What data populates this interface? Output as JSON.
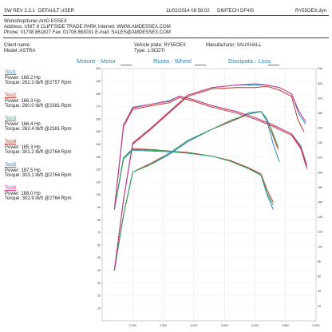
{
  "header": {
    "software": "SW REV 2.3.1",
    "user": "DEFAULT USER",
    "datetime": "11/02/2014 08:59:02",
    "dyno_model": "DIMTECH DF4IS",
    "file": "RY55OEX.dyn",
    "workshop_name": "Workshop/tuner:AmD ESSEX",
    "address": "Address: UNIT 6 CLIFFSIDE TRADE PARK Internet: WWW.AMDESSEX.COM",
    "phone": "Phone: 01708 861827 Fax: 01708 863031 E-mail: SALES@AMDESSEX.COM"
  },
  "vehicle": {
    "client_name_label": "Client name:",
    "model": "Model: ASTRA",
    "plate": "Vehicle plate: RY55OEX",
    "type": "Type: 1.9CDTI",
    "manufacturer": "Manufacturer: VAUXHALL"
  },
  "legend": [
    "Motore - Motor",
    "Ruota - Wheel",
    "Dissipata - Loss"
  ],
  "tests": [
    {
      "name": "Test1",
      "color": "#2e86c1",
      "power": "Power: 166.2 Hp",
      "torque": "Torque: 262.3 lb/ft @2757 Rpm"
    },
    {
      "name": "Test2",
      "color": "#c0392b",
      "power": "Power: 166.3 Hp",
      "torque": "Torque: 260.0 lb/ft @2381 Rpm"
    },
    {
      "name": "Test3",
      "color": "#27ae60",
      "power": "Power: 166.4 Hp",
      "torque": "Torque: 262.4 lb/ft @2381 Rpm"
    },
    {
      "name": "Test4",
      "color": "#c0392b",
      "power": "Power: 185.3 Hp",
      "torque": "Torque: 301.2 lb/ft @2764 Rpm"
    },
    {
      "name": "Test5",
      "color": "#2e86c1",
      "power": "Power: 187.5 Hp",
      "torque": "Torque: 303.1 lb/ft @2764 Rpm"
    },
    {
      "name": "Test6",
      "color": "#d63384",
      "power": "Power: 188.0 Hp",
      "torque": "Torque: 302.9 lb/ft @2764 Rpm"
    }
  ],
  "chart_data": {
    "type": "line",
    "xlim": [
      1500,
      5000
    ],
    "x_ticks": [
      2000,
      2500,
      3000,
      3500,
      4000,
      4500,
      5000
    ],
    "power_ylim": [
      0,
      200
    ],
    "power_ticks": [
      10,
      20,
      30,
      40,
      50,
      60,
      70,
      80,
      90,
      100,
      110,
      120,
      130,
      140,
      150,
      160,
      170,
      180,
      190,
      200
    ],
    "torque_ylim": [
      0,
      340
    ],
    "torque_ticks": [
      20,
      40,
      60,
      80,
      100,
      120,
      140,
      160,
      180,
      200,
      220,
      240,
      260,
      280,
      300,
      320,
      340
    ],
    "series": [
      {
        "color": "#2e86c1",
        "kind": "power",
        "x": [
          1700,
          1850,
          2000,
          2300,
          2600,
          2900,
          3300,
          3600,
          3900,
          4100,
          4200,
          4300,
          4400
        ],
        "y": [
          40,
          84,
          118,
          124,
          132,
          142,
          152,
          158,
          165,
          166,
          158,
          140,
          126
        ]
      },
      {
        "color": "#c0392b",
        "kind": "power",
        "x": [
          1700,
          1850,
          2000,
          2300,
          2600,
          2900,
          3300,
          3600,
          3900,
          4100,
          4200,
          4300,
          4380
        ],
        "y": [
          40,
          84,
          118,
          125,
          133,
          143,
          152,
          158,
          164,
          166,
          160,
          146,
          136
        ]
      },
      {
        "color": "#27ae60",
        "kind": "power",
        "x": [
          1700,
          1850,
          2000,
          2300,
          2600,
          2900,
          3300,
          3600,
          3900,
          4100,
          4200,
          4300,
          4380
        ],
        "y": [
          40,
          84,
          118,
          124,
          133,
          143,
          152,
          159,
          164,
          166,
          160,
          148,
          138
        ]
      },
      {
        "color": "#c0392b",
        "kind": "power",
        "x": [
          1700,
          1850,
          2000,
          2300,
          2600,
          2900,
          3300,
          3700,
          4000,
          4200,
          4400,
          4600,
          4700,
          4800
        ],
        "y": [
          40,
          96,
          140,
          152,
          165,
          178,
          184,
          185,
          185,
          186,
          183,
          178,
          160,
          150
        ]
      },
      {
        "color": "#2e86c1",
        "kind": "power",
        "x": [
          1700,
          1850,
          2000,
          2300,
          2600,
          2900,
          3300,
          3700,
          4000,
          4200,
          4400,
          4600,
          4720,
          4830
        ],
        "y": [
          40,
          96,
          141,
          153,
          166,
          179,
          185,
          187,
          187,
          187,
          185,
          180,
          164,
          156
        ]
      },
      {
        "color": "#d63384",
        "kind": "power",
        "x": [
          1700,
          1850,
          2000,
          2300,
          2600,
          2900,
          3300,
          3700,
          4000,
          4200,
          4400,
          4600,
          4720,
          4830
        ],
        "y": [
          40,
          96,
          141,
          153,
          166,
          179,
          185,
          187,
          188,
          187,
          185,
          180,
          166,
          158
        ]
      },
      {
        "color": "#2e86c1",
        "kind": "torque",
        "x": [
          1700,
          1850,
          2000,
          2300,
          2600,
          2900,
          3300,
          3600,
          3900,
          4100,
          4200,
          4300
        ],
        "y": [
          150,
          218,
          230,
          229,
          228,
          226,
          222,
          216,
          206,
          196,
          170,
          150
        ]
      },
      {
        "color": "#c0392b",
        "kind": "torque",
        "x": [
          1700,
          1850,
          2000,
          2300,
          2600,
          2900,
          3300,
          3600,
          3900,
          4100,
          4200,
          4300
        ],
        "y": [
          150,
          220,
          232,
          231,
          229,
          227,
          222,
          216,
          206,
          198,
          176,
          160
        ]
      },
      {
        "color": "#27ae60",
        "kind": "torque",
        "x": [
          1700,
          1850,
          2000,
          2300,
          2600,
          2900,
          3300,
          3600,
          3900,
          4100,
          4200,
          4300
        ],
        "y": [
          150,
          220,
          231,
          230,
          229,
          226,
          222,
          215,
          205,
          196,
          172,
          156
        ]
      },
      {
        "color": "#c0392b",
        "kind": "torque",
        "x": [
          1700,
          1850,
          2000,
          2300,
          2600,
          2764,
          3000,
          3300,
          3700,
          4000,
          4300,
          4600,
          4750,
          4850
        ],
        "y": [
          150,
          262,
          285,
          290,
          294,
          301,
          296,
          288,
          280,
          272,
          262,
          250,
          232,
          205
        ]
      },
      {
        "color": "#2e86c1",
        "kind": "torque",
        "x": [
          1700,
          1850,
          2000,
          2300,
          2600,
          2764,
          3000,
          3300,
          3700,
          4000,
          4300,
          4600,
          4750,
          4850
        ],
        "y": [
          150,
          264,
          288,
          292,
          297,
          303,
          298,
          290,
          282,
          274,
          264,
          252,
          236,
          210
        ]
      },
      {
        "color": "#d63384",
        "kind": "torque",
        "x": [
          1700,
          1850,
          2000,
          2300,
          2600,
          2764,
          3000,
          3300,
          3700,
          4000,
          4300,
          4600,
          4750,
          4850
        ],
        "y": [
          150,
          264,
          287,
          292,
          296,
          303,
          298,
          290,
          282,
          274,
          264,
          252,
          234,
          208
        ]
      }
    ]
  }
}
